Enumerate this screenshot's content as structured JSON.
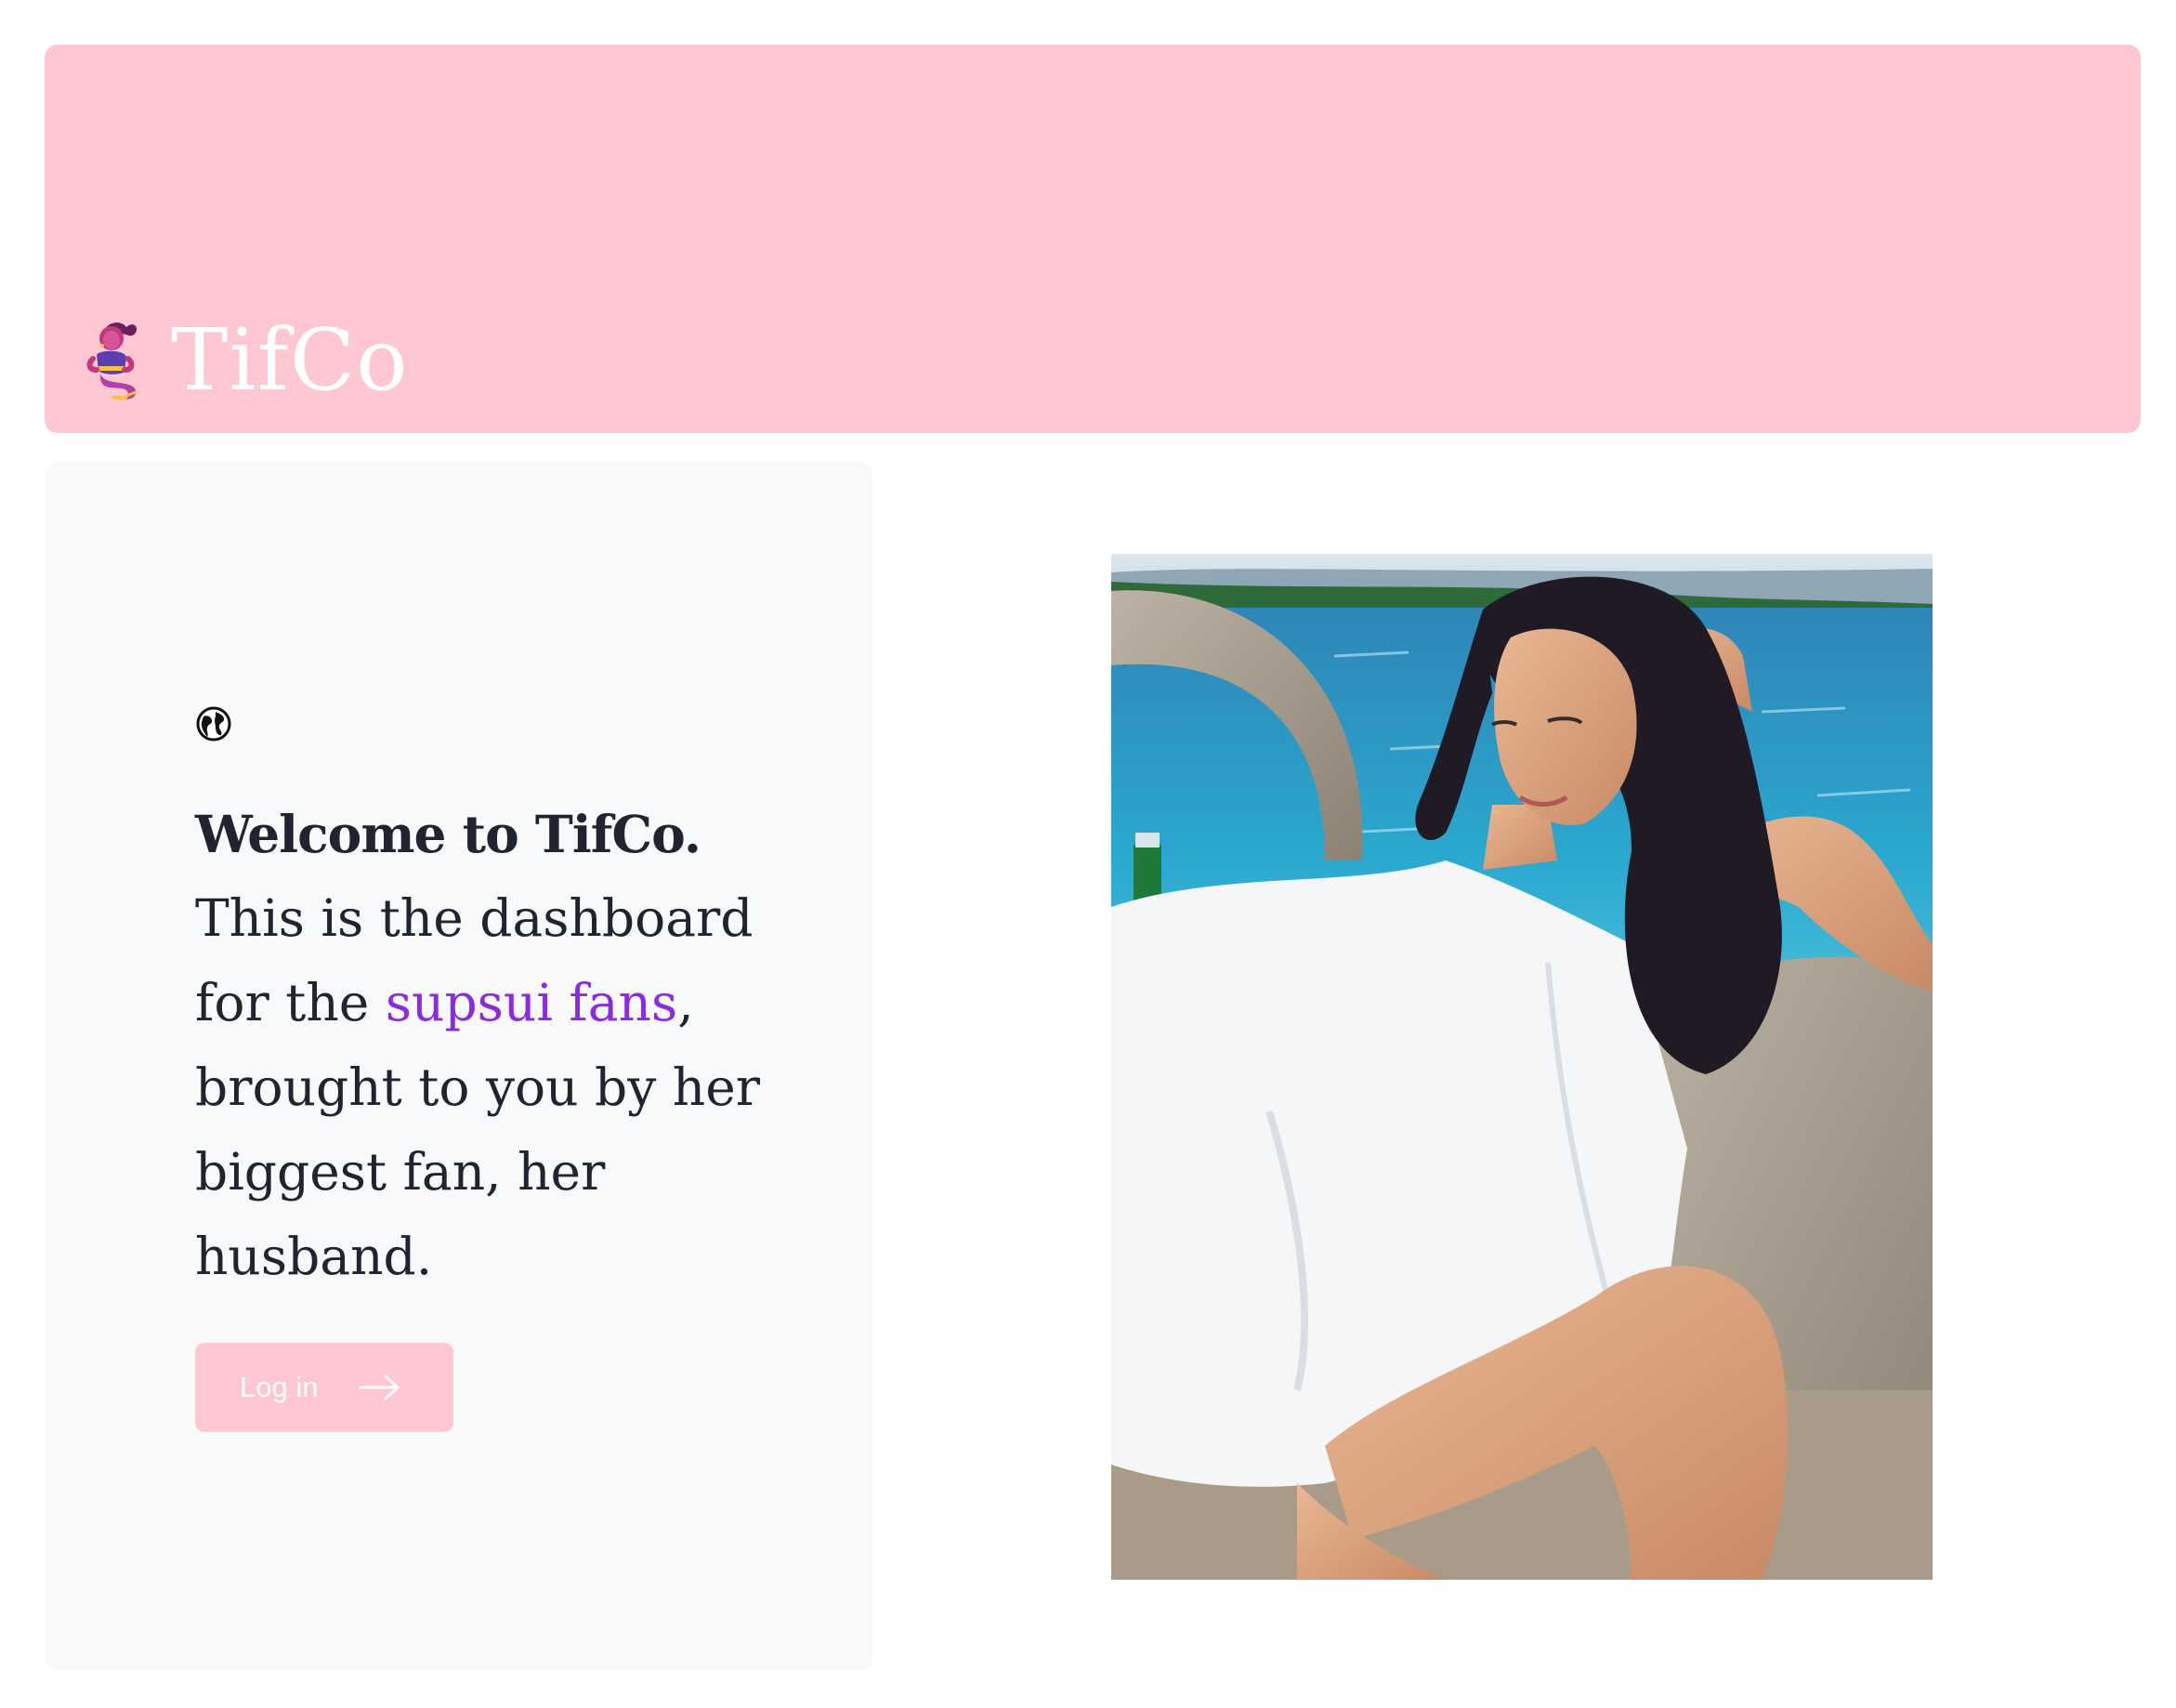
{
  "header": {
    "brand_name": "TifCo",
    "background_color": "#ffc7d2",
    "logo_icon": "genie-emoji-icon"
  },
  "panel": {
    "icon": "globe-icon",
    "title": "Welcome to TifCo.",
    "body_before": "This is the dashboard for the ",
    "body_link": "supsui fans",
    "body_after": ", brought to you by her biggest fan, her husband.",
    "accent_color": "#8a2be2",
    "login_button": {
      "label": "Log in",
      "icon": "arrow-right-icon"
    }
  },
  "photo": {
    "subject": "portrait-photo"
  }
}
